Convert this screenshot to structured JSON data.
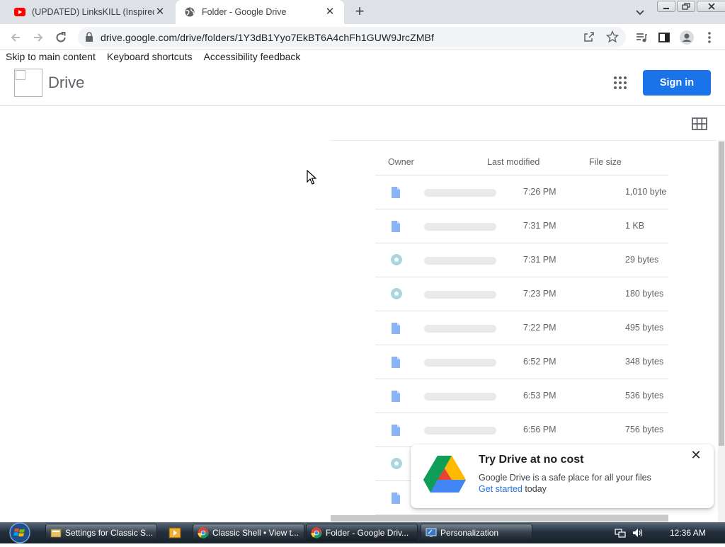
{
  "browser": {
    "tabs": [
      {
        "title": "(UPDATED) LinksKILL (Inspired By",
        "icon": "youtube-icon"
      },
      {
        "title": "Folder - Google Drive",
        "icon": "globe-icon"
      }
    ],
    "url": "drive.google.com/drive/folders/1Y3dB1Yyo7EkBT6A4chFh1GUW9JrcZMBf"
  },
  "skip_links": [
    "Skip to main content",
    "Keyboard shortcuts",
    "Accessibility feedback"
  ],
  "header": {
    "title": "Drive",
    "signin_label": "Sign in"
  },
  "columns": {
    "owner": "Owner",
    "modified": "Last modified",
    "size": "File size"
  },
  "files": [
    {
      "modified": "7:26 PM",
      "size": "1,010 byte",
      "icon": "doc-icon"
    },
    {
      "modified": "7:31 PM",
      "size": "1 KB",
      "icon": "doc-icon"
    },
    {
      "modified": "7:31 PM",
      "size": "29 bytes",
      "icon": "circle-file-icon"
    },
    {
      "modified": "7:23 PM",
      "size": "180 bytes",
      "icon": "circle-file-icon"
    },
    {
      "modified": "7:22 PM",
      "size": "495 bytes",
      "icon": "doc-icon"
    },
    {
      "modified": "6:52 PM",
      "size": "348 bytes",
      "icon": "doc-icon"
    },
    {
      "modified": "6:53 PM",
      "size": "536 bytes",
      "icon": "doc-icon"
    },
    {
      "modified": "6:56 PM",
      "size": "756 bytes",
      "icon": "doc-icon"
    },
    {
      "modified": "",
      "size": "",
      "icon": "circle-file-icon"
    },
    {
      "modified": "",
      "size": "",
      "icon": "doc-icon"
    }
  ],
  "promo": {
    "title": "Try Drive at no cost",
    "description": "Google Drive is a safe place for all your files",
    "link": "Get started",
    "link_suffix": " today"
  },
  "taskbar": {
    "buttons": [
      {
        "label": "Settings for Classic S..."
      },
      {
        "label": "Classic Shell • View t..."
      },
      {
        "label": "Folder - Google Driv..."
      },
      {
        "label": "Personalization"
      }
    ],
    "clock": "12:36 AM"
  },
  "colors": {
    "accent": "#1a73e8",
    "doc_icon": "#8ab4f8",
    "circle_icon": "#a8d8dc"
  }
}
